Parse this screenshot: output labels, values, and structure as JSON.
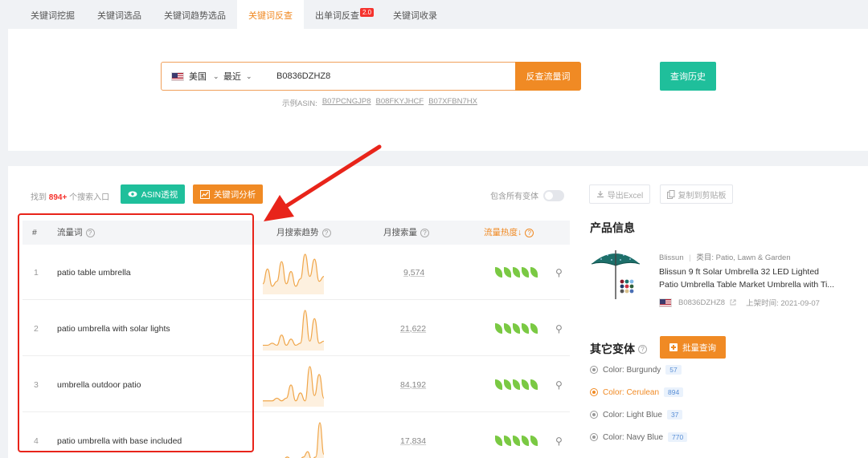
{
  "tabs": [
    {
      "label": "关键词挖掘"
    },
    {
      "label": "关键词选品"
    },
    {
      "label": "关键词趋势选品"
    },
    {
      "label": "关键词反查"
    },
    {
      "label": "出单词反查",
      "badge": "2.0"
    },
    {
      "label": "关键词收录"
    }
  ],
  "search": {
    "country": "美国",
    "period": "最近",
    "asin_value": "B0836DZHZ8",
    "submit_label": "反查流量词",
    "history_label": "查询历史",
    "examples_prefix": "示例ASIN:",
    "examples": [
      "B07PCNGJP8",
      "B08FKYJHCF",
      "B07XFBN7HX"
    ]
  },
  "results": {
    "found_prefix": "找到",
    "found_count": "894+",
    "found_suffix": "个搜索入口",
    "asin_button": "ASIN透视",
    "keyword_button": "关键词分析",
    "variants_toggle_label": "包含所有变体",
    "columns": {
      "index": "#",
      "keyword": "流量词",
      "trend": "月搜索趋势",
      "volume": "月搜索量",
      "heat": "流量热度↓"
    },
    "rows": [
      {
        "index": "1",
        "keyword": "patio table umbrella",
        "volume": "9,574",
        "heat": 5,
        "trend": [
          3,
          9,
          2,
          4,
          12,
          3,
          8,
          2,
          5,
          15,
          6,
          13,
          4,
          6
        ]
      },
      {
        "index": "2",
        "keyword": "patio umbrella with solar lights",
        "volume": "21,622",
        "heat": 5,
        "trend": [
          1,
          1,
          2,
          1,
          6,
          1,
          4,
          1,
          2,
          18,
          3,
          14,
          2,
          3
        ]
      },
      {
        "index": "3",
        "keyword": "umbrella outdoor patio",
        "volume": "84,192",
        "heat": 5,
        "trend": [
          1,
          1,
          1,
          2,
          1,
          2,
          7,
          1,
          4,
          1,
          14,
          3,
          11,
          2
        ]
      },
      {
        "index": "4",
        "keyword": "patio umbrella with base included",
        "volume": "17,834",
        "heat": 5,
        "trend": [
          0,
          0,
          0,
          0,
          0,
          0,
          1,
          0,
          0,
          0,
          1,
          3,
          0,
          1,
          14,
          2
        ]
      }
    ]
  },
  "sidebar": {
    "export_label": "导出Excel",
    "copy_label": "复制到剪贴板",
    "product_section_title": "产品信息",
    "brand": "Blissun",
    "category_label": "类目: Patio, Lawn & Garden",
    "product_title_line1": "Blissun 9 ft Solar Umbrella 32 LED Lighted",
    "product_title_line2": "Patio Umbrella Table Market Umbrella with Ti...",
    "product_asin": "B0836DZHZ8",
    "listed_date": "上架时间: 2021-09-07",
    "variants_section_title": "其它变体",
    "batch_button": "批量查询",
    "variants": [
      {
        "label": "Color: Burgundy",
        "count": "57"
      },
      {
        "label": "Color: Cerulean",
        "count": "894",
        "active": true
      },
      {
        "label": "Color: Light Blue",
        "count": "37"
      },
      {
        "label": "Color: Navy Blue",
        "count": "770"
      }
    ]
  },
  "colors": {
    "accent_orange": "#f08a24",
    "accent_teal": "#1fbf9b",
    "highlight_red": "#e8241a",
    "trend_line": "#f0a64a"
  }
}
